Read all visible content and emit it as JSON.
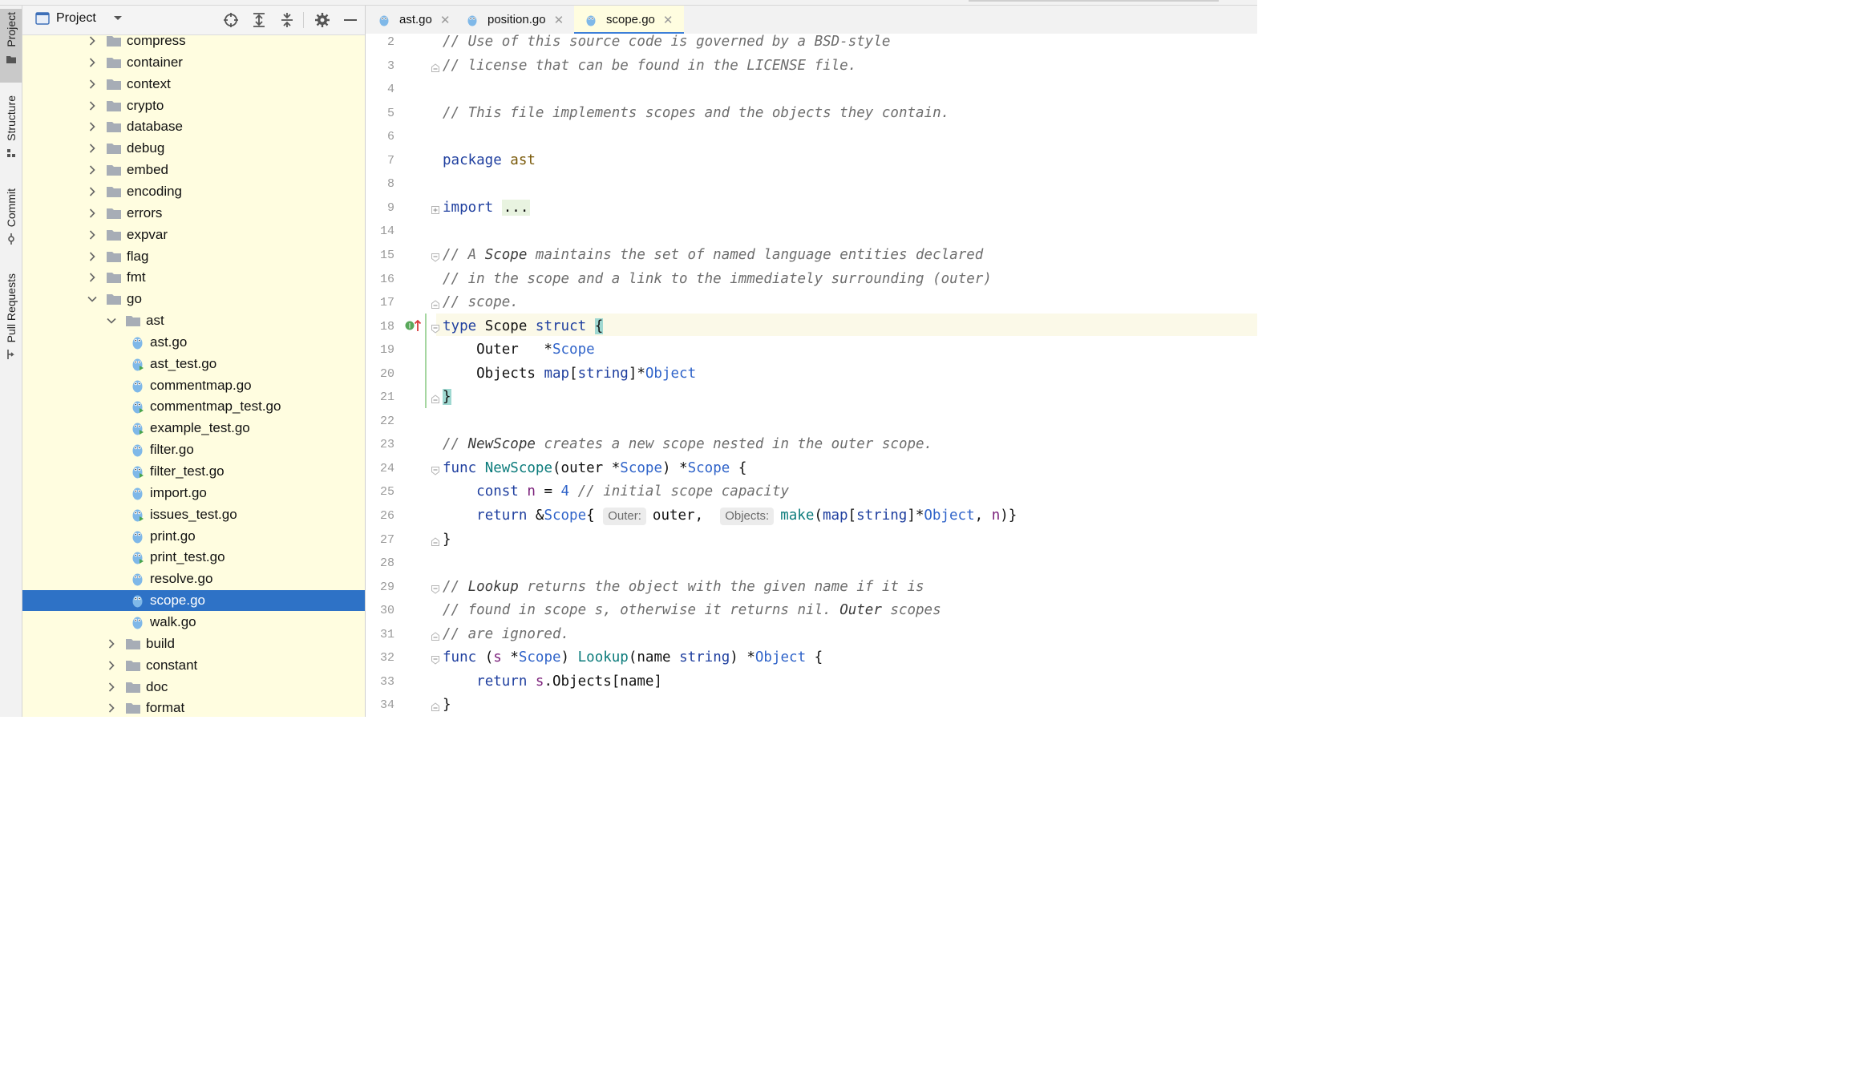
{
  "project_panel": {
    "title": "Project",
    "tree": [
      {
        "label": "compress",
        "kind": "folder",
        "level": 0,
        "expanded": false
      },
      {
        "label": "container",
        "kind": "folder",
        "level": 0,
        "expanded": false
      },
      {
        "label": "context",
        "kind": "folder",
        "level": 0,
        "expanded": false
      },
      {
        "label": "crypto",
        "kind": "folder",
        "level": 0,
        "expanded": false
      },
      {
        "label": "database",
        "kind": "folder",
        "level": 0,
        "expanded": false
      },
      {
        "label": "debug",
        "kind": "folder",
        "level": 0,
        "expanded": false
      },
      {
        "label": "embed",
        "kind": "folder",
        "level": 0,
        "expanded": false
      },
      {
        "label": "encoding",
        "kind": "folder",
        "level": 0,
        "expanded": false
      },
      {
        "label": "errors",
        "kind": "folder",
        "level": 0,
        "expanded": false
      },
      {
        "label": "expvar",
        "kind": "folder",
        "level": 0,
        "expanded": false
      },
      {
        "label": "flag",
        "kind": "folder",
        "level": 0,
        "expanded": false
      },
      {
        "label": "fmt",
        "kind": "folder",
        "level": 0,
        "expanded": false
      },
      {
        "label": "go",
        "kind": "folder",
        "level": 0,
        "expanded": true
      },
      {
        "label": "ast",
        "kind": "folder",
        "level": 1,
        "expanded": true
      },
      {
        "label": "ast.go",
        "kind": "file",
        "level": 2
      },
      {
        "label": "ast_test.go",
        "kind": "testfile",
        "level": 2
      },
      {
        "label": "commentmap.go",
        "kind": "file",
        "level": 2
      },
      {
        "label": "commentmap_test.go",
        "kind": "testfile",
        "level": 2
      },
      {
        "label": "example_test.go",
        "kind": "testfile",
        "level": 2
      },
      {
        "label": "filter.go",
        "kind": "file",
        "level": 2
      },
      {
        "label": "filter_test.go",
        "kind": "testfile",
        "level": 2
      },
      {
        "label": "import.go",
        "kind": "file",
        "level": 2
      },
      {
        "label": "issues_test.go",
        "kind": "testfile",
        "level": 2
      },
      {
        "label": "print.go",
        "kind": "file",
        "level": 2
      },
      {
        "label": "print_test.go",
        "kind": "testfile",
        "level": 2
      },
      {
        "label": "resolve.go",
        "kind": "file",
        "level": 2
      },
      {
        "label": "scope.go",
        "kind": "file",
        "level": 2,
        "selected": true
      },
      {
        "label": "walk.go",
        "kind": "file",
        "level": 2
      },
      {
        "label": "build",
        "kind": "folder",
        "level": 1,
        "expanded": false
      },
      {
        "label": "constant",
        "kind": "folder",
        "level": 1,
        "expanded": false
      },
      {
        "label": "doc",
        "kind": "folder",
        "level": 1,
        "expanded": false
      },
      {
        "label": "format",
        "kind": "folder",
        "level": 1,
        "expanded": false
      }
    ]
  },
  "tool_strip": [
    "Project",
    "Structure",
    "Commit",
    "Pull Requests"
  ],
  "tabs": [
    {
      "label": "ast.go",
      "active": false
    },
    {
      "label": "position.go",
      "active": false
    },
    {
      "label": "scope.go",
      "active": true
    }
  ],
  "editor": {
    "lines": [
      {
        "n": "2",
        "tokens": [
          [
            "cm",
            "// Use of this source code is governed by a BSD-style"
          ]
        ]
      },
      {
        "n": "3",
        "tokens": [
          [
            "cm",
            "// license that can be found in the LICENSE file."
          ]
        ]
      },
      {
        "n": "4",
        "tokens": []
      },
      {
        "n": "5",
        "tokens": [
          [
            "cm",
            "// This file implements scopes and the objects they contain."
          ]
        ]
      },
      {
        "n": "6",
        "tokens": []
      },
      {
        "n": "7",
        "tokens": [
          [
            "kw",
            "package"
          ],
          [
            "",
            ""
          ],
          [
            "pk",
            " ast"
          ]
        ]
      },
      {
        "n": "8",
        "tokens": []
      },
      {
        "n": "9",
        "tokens": [
          [
            "kw",
            "import"
          ],
          [
            "",
            " "
          ],
          [
            "dots",
            "..."
          ]
        ]
      },
      {
        "n": "14",
        "tokens": []
      },
      {
        "n": "15",
        "tokens": [
          [
            "cm",
            "// A "
          ],
          [
            "cmk",
            "Scope"
          ],
          [
            "cm",
            " maintains the set of named language entities declared"
          ]
        ]
      },
      {
        "n": "16",
        "tokens": [
          [
            "cm",
            "// in the scope and a link to the immediately surrounding (outer)"
          ]
        ]
      },
      {
        "n": "17",
        "tokens": [
          [
            "cm",
            "// scope."
          ]
        ]
      },
      {
        "n": "18",
        "tokens": [
          [
            "kw",
            "type"
          ],
          [
            "",
            " Scope "
          ],
          [
            "kw",
            "struct"
          ],
          [
            "",
            " "
          ],
          [
            "brace",
            "{"
          ]
        ]
      },
      {
        "n": "19",
        "tokens": [
          [
            "",
            "    Outer   *"
          ],
          [
            "ty",
            "Scope"
          ]
        ]
      },
      {
        "n": "20",
        "tokens": [
          [
            "",
            "    Objects "
          ],
          [
            "kw",
            "map"
          ],
          [
            "",
            "["
          ],
          [
            "kw",
            "string"
          ],
          [
            "",
            "]*"
          ],
          [
            "ty",
            "Object"
          ]
        ]
      },
      {
        "n": "21",
        "tokens": [
          [
            "brace",
            "}"
          ]
        ]
      },
      {
        "n": "22",
        "tokens": []
      },
      {
        "n": "23",
        "tokens": [
          [
            "cm",
            "// "
          ],
          [
            "cmk",
            "NewScope"
          ],
          [
            "cm",
            " creates a new scope nested in the outer scope."
          ]
        ]
      },
      {
        "n": "24",
        "tokens": [
          [
            "kw",
            "func"
          ],
          [
            "",
            " "
          ],
          [
            "fn",
            "NewScope"
          ],
          [
            "",
            "(outer *"
          ],
          [
            "ty",
            "Scope"
          ],
          [
            "",
            ") *"
          ],
          [
            "ty",
            "Scope"
          ],
          [
            "",
            " {"
          ]
        ]
      },
      {
        "n": "25",
        "tokens": [
          [
            "",
            "    "
          ],
          [
            "kw",
            "const"
          ],
          [
            "",
            " "
          ],
          [
            "var",
            "n"
          ],
          [
            "",
            " = "
          ],
          [
            "num",
            "4"
          ],
          [
            "",
            " "
          ],
          [
            "cm",
            "// initial scope capacity"
          ]
        ]
      },
      {
        "n": "26",
        "tokens": [
          [
            "",
            "    "
          ],
          [
            "kw",
            "return"
          ],
          [
            "",
            " &"
          ],
          [
            "ty",
            "Scope"
          ],
          [
            "",
            "{ "
          ],
          [
            "hint",
            "Outer:"
          ],
          [
            "",
            "outer,  "
          ],
          [
            "hint",
            "Objects:"
          ],
          [
            "fn",
            "make"
          ],
          [
            "",
            "("
          ],
          [
            "kw",
            "map"
          ],
          [
            "",
            "["
          ],
          [
            "kw",
            "string"
          ],
          [
            "",
            "]*"
          ],
          [
            "ty",
            "Object"
          ],
          [
            "",
            ", "
          ],
          [
            "var",
            "n"
          ],
          [
            "",
            ")}"
          ]
        ]
      },
      {
        "n": "27",
        "tokens": [
          [
            "",
            "}"
          ]
        ]
      },
      {
        "n": "28",
        "tokens": []
      },
      {
        "n": "29",
        "tokens": [
          [
            "cm",
            "// "
          ],
          [
            "cmk",
            "Lookup"
          ],
          [
            "cm",
            " returns the object with the given name if it is"
          ]
        ]
      },
      {
        "n": "30",
        "tokens": [
          [
            "cm",
            "// found in scope s, otherwise it returns nil. "
          ],
          [
            "cmk",
            "Outer"
          ],
          [
            "cm",
            " scopes"
          ]
        ]
      },
      {
        "n": "31",
        "tokens": [
          [
            "cm",
            "// are ignored."
          ]
        ]
      },
      {
        "n": "32",
        "tokens": [
          [
            "kw",
            "func"
          ],
          [
            "",
            " ("
          ],
          [
            "var",
            "s"
          ],
          [
            "",
            " *"
          ],
          [
            "ty",
            "Scope"
          ],
          [
            "",
            ") "
          ],
          [
            "fn",
            "Lookup"
          ],
          [
            "",
            "(name "
          ],
          [
            "kw",
            "string"
          ],
          [
            "",
            ") *"
          ],
          [
            "ty",
            "Object"
          ],
          [
            "",
            " {"
          ]
        ]
      },
      {
        "n": "33",
        "tokens": [
          [
            "",
            "    "
          ],
          [
            "kw",
            "return"
          ],
          [
            "",
            " "
          ],
          [
            "var",
            "s"
          ],
          [
            "",
            ".Objects[name]"
          ]
        ]
      },
      {
        "n": "34",
        "tokens": [
          [
            "",
            "}"
          ]
        ]
      }
    ]
  },
  "colors": {
    "selection": "#2e72c6",
    "project_bg": "#fffde0",
    "keyword": "#1f3f9f",
    "comment": "#6e6e6e",
    "type": "#2f63c9",
    "function": "#0b7b7b",
    "tab_underline": "#3d7fd8"
  },
  "icons": {
    "toolbar": [
      "locate-icon",
      "expand-all-icon",
      "collapse-all-icon",
      "gear-icon",
      "minimize-icon"
    ],
    "gutter_line_18": "implemented-interface-icon"
  }
}
